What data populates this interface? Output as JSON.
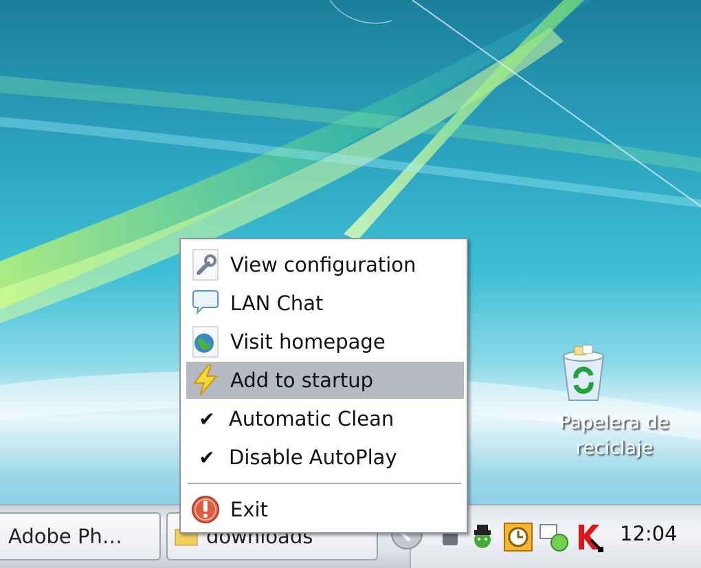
{
  "desktop": {
    "recycle_bin": {
      "label_line1": "Papelera de",
      "label_line2": "reciclaje",
      "icon": "recycle-bin-icon"
    }
  },
  "context_menu": {
    "items": [
      {
        "label": "View configuration",
        "icon": "wrench-icon",
        "checked": false,
        "highlighted": false
      },
      {
        "label": "LAN Chat",
        "icon": "chat-bubble-icon",
        "checked": false,
        "highlighted": false
      },
      {
        "label": "Visit homepage",
        "icon": "globe-icon",
        "checked": false,
        "highlighted": false
      },
      {
        "label": "Add to startup",
        "icon": "lightning-icon",
        "checked": false,
        "highlighted": true
      },
      {
        "label": "Automatic Clean",
        "icon": "checkmark-icon",
        "checked": true,
        "highlighted": false
      },
      {
        "label": "Disable AutoPlay",
        "icon": "checkmark-icon",
        "checked": true,
        "highlighted": false
      },
      {
        "label": "Exit",
        "icon": "exit-icon",
        "checked": false,
        "highlighted": false
      }
    ],
    "check_glyph": "✔",
    "highlight_color": "#b6b8c2"
  },
  "taskbar": {
    "buttons": [
      {
        "label": "Adobe Ph…"
      },
      {
        "label": "downloads",
        "icon": "folder-icon"
      }
    ],
    "tray_icons": [
      "show-hidden-icon",
      "usb-icon",
      "agent-icon",
      "clock-icon",
      "network-icon",
      "kaspersky-icon"
    ],
    "clock": "12:04"
  }
}
